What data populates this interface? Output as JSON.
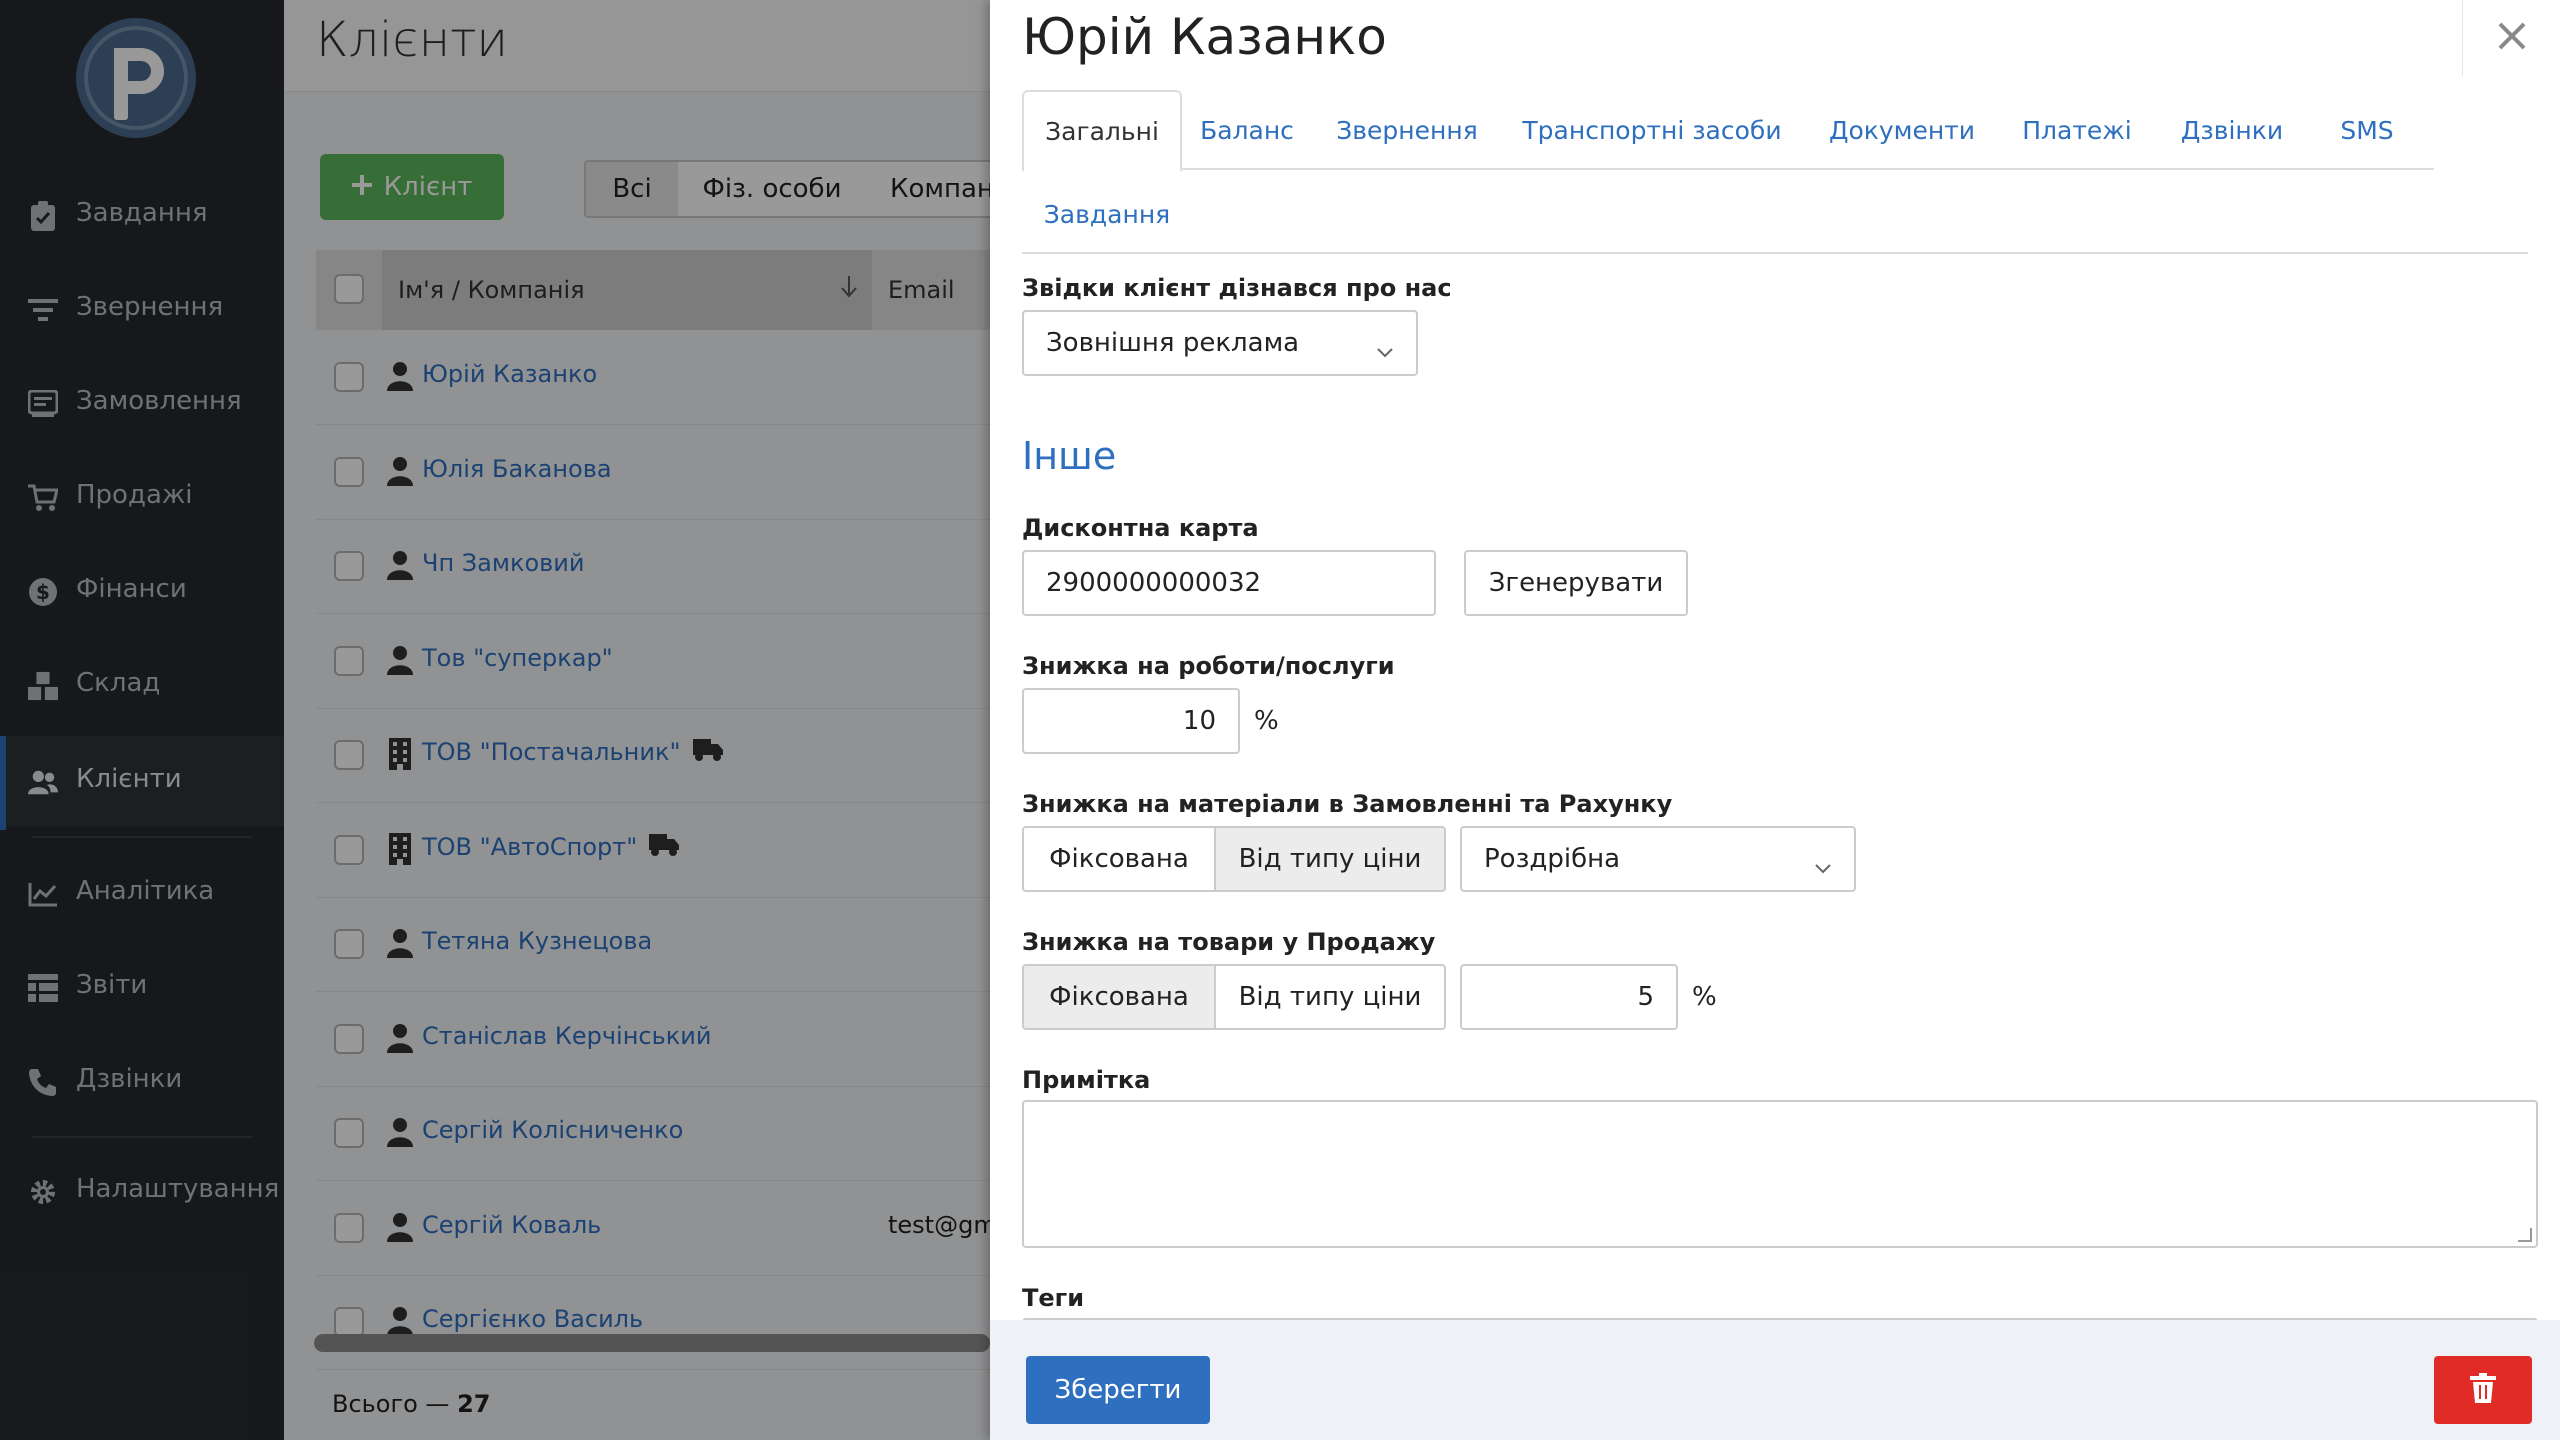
{
  "sidebar": {
    "logo": "logo-p-icon",
    "items": [
      {
        "label": "Завдання",
        "icon": "clipboard-icon"
      },
      {
        "label": "Звернення",
        "icon": "filter-icon"
      },
      {
        "label": "Замовлення",
        "icon": "order-icon"
      },
      {
        "label": "Продажі",
        "icon": "cart-icon"
      },
      {
        "label": "Фінанси",
        "icon": "dollar-icon"
      },
      {
        "label": "Склад",
        "icon": "boxes-icon"
      },
      {
        "label": "Клієнти",
        "icon": "users-icon",
        "active": true
      },
      {
        "label": "Аналітика",
        "icon": "chart-line-icon"
      },
      {
        "label": "Звіти",
        "icon": "table-icon"
      },
      {
        "label": "Дзвінки",
        "icon": "phone-icon"
      },
      {
        "label": "Налаштування",
        "icon": "cog-icon"
      }
    ]
  },
  "clients": {
    "title": "Клієнти",
    "add_button": "Клієнт",
    "filters": [
      "Всі",
      "Фіз. особи",
      "Компанії"
    ],
    "columns": {
      "name": "Ім'я / Компанія",
      "email": "Email"
    },
    "rows": [
      {
        "name": "Юрій Казанко",
        "type": "person",
        "email": ""
      },
      {
        "name": "Юлія Баканова",
        "type": "person",
        "email": ""
      },
      {
        "name": "Чп Замковий",
        "type": "person",
        "email": ""
      },
      {
        "name": "Тов \"суперкар\"",
        "type": "person",
        "email": ""
      },
      {
        "name": "ТОВ \"Постачальник\"",
        "type": "company-supplier",
        "email": ""
      },
      {
        "name": "ТОВ \"АвтоСпорт\"",
        "type": "company-supplier",
        "email": ""
      },
      {
        "name": "Тетяна Кузнецова",
        "type": "person",
        "email": ""
      },
      {
        "name": "Станіслав Керчінський",
        "type": "person",
        "email": ""
      },
      {
        "name": "Сергій Колісниченко",
        "type": "person",
        "email": ""
      },
      {
        "name": "Сергій Коваль",
        "type": "person",
        "email": "test@gm"
      },
      {
        "name": "Сергієнко Василь",
        "type": "person",
        "email": ""
      }
    ],
    "total_label": "Всього —",
    "total_value": "27"
  },
  "panel": {
    "title": "Юрій Казанко",
    "tabs": [
      "Загальні",
      "Баланс",
      "Звернення",
      "Транспортні засоби",
      "Документи",
      "Платежі",
      "Дзвінки",
      "SMS"
    ],
    "tabs_row2": [
      "Завдання"
    ],
    "source": {
      "label": "Звідки клієнт дізнався про нас",
      "value": "Зовнішня реклама"
    },
    "section_other": "Інше",
    "discount_card": {
      "label": "Дисконтна карта",
      "value": "2900000000032",
      "generate_button": "Згенерувати"
    },
    "service_discount": {
      "label": "Знижка на роботи/послуги",
      "value": "10",
      "unit": "%"
    },
    "materials_discount": {
      "label": "Знижка на матеріали в Замовленні та Рахунку",
      "option_fixed": "Фіксована",
      "option_price_type": "Від типу ціни",
      "selected": "price_type",
      "price_type_value": "Роздрібна"
    },
    "goods_discount": {
      "label": "Знижка на товари у Продажу",
      "option_fixed": "Фіксована",
      "option_price_type": "Від типу ціни",
      "selected": "fixed",
      "value": "5",
      "unit": "%"
    },
    "note": {
      "label": "Примітка",
      "value": ""
    },
    "tags": {
      "label": "Теги"
    },
    "save_button": "Зберегти"
  },
  "colors": {
    "accent": "#2e6fbf",
    "success": "#5cb85c",
    "danger": "#e02b27",
    "sidebar": "#26292e"
  }
}
